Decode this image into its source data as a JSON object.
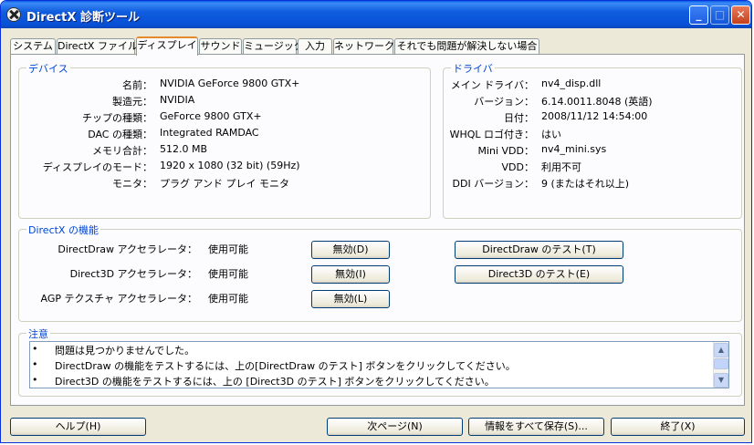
{
  "window": {
    "title": "DirectX 診断ツール"
  },
  "tabs": [
    {
      "label": "システム"
    },
    {
      "label": "DirectX ファイル"
    },
    {
      "label": "ディスプレイ"
    },
    {
      "label": "サウンド"
    },
    {
      "label": "ミュージック"
    },
    {
      "label": "入力"
    },
    {
      "label": "ネットワーク"
    },
    {
      "label": "それでも問題が解決しない場合"
    }
  ],
  "device": {
    "title": "デバイス",
    "rows": [
      {
        "label": "名前：",
        "value": "NVIDIA GeForce 9800 GTX+"
      },
      {
        "label": "製造元：",
        "value": "NVIDIA"
      },
      {
        "label": "チップの種類：",
        "value": "GeForce 9800 GTX+"
      },
      {
        "label": "DAC の種類：",
        "value": "Integrated RAMDAC"
      },
      {
        "label": "メモリ合計：",
        "value": "512.0 MB"
      },
      {
        "label": "ディスプレイのモード：",
        "value": "1920 x 1080 (32 bit) (59Hz)"
      },
      {
        "label": "モニタ：",
        "value": "プラグ アンド プレイ モニタ"
      }
    ]
  },
  "driver": {
    "title": "ドライバ",
    "rows": [
      {
        "label": "メイン ドライバ：",
        "value": "nv4_disp.dll"
      },
      {
        "label": "バージョン：",
        "value": "6.14.0011.8048 (英語)"
      },
      {
        "label": "日付：",
        "value": "2008/11/12 14:54:00"
      },
      {
        "label": "WHQL ロゴ付き：",
        "value": "はい"
      },
      {
        "label": "Mini VDD：",
        "value": "nv4_mini.sys"
      },
      {
        "label": "VDD：",
        "value": "利用不可"
      },
      {
        "label": "DDI バージョン：",
        "value": "9 (またはそれ以上)"
      }
    ]
  },
  "features": {
    "title": "DirectX の機能",
    "rows": [
      {
        "label": "DirectDraw アクセラレータ：",
        "status": "使用可能",
        "disable_button": "無効(D)",
        "test_button": "DirectDraw のテスト(T)"
      },
      {
        "label": "Direct3D アクセラレータ：",
        "status": "使用可能",
        "disable_button": "無効(I)",
        "test_button": "Direct3D のテスト(E)"
      },
      {
        "label": "AGP テクスチャ アクセラレータ：",
        "status": "使用可能",
        "disable_button": "無効(L)"
      }
    ]
  },
  "notes": {
    "title": "注意",
    "bullet": "•",
    "items": [
      "問題は見つかりませんでした。",
      "DirectDraw の機能をテストするには、上の[DirectDraw のテスト] ボタンをクリックしてください。",
      "Direct3D の機能をテストするには、上の [Direct3D のテスト] ボタンをクリックしてください。"
    ]
  },
  "buttons": {
    "help": "ヘルプ(H)",
    "next": "次ページ(N)",
    "save": "情報をすべて保存(S)...",
    "exit": "終了(X)"
  },
  "icons": {
    "app": "directx-icon",
    "minimize": "minimize-icon",
    "maximize": "maximize-icon",
    "close": "close-icon",
    "scroll_up": "scroll-up-arrow-icon",
    "scroll_down": "scroll-down-arrow-icon"
  },
  "colors": {
    "titlebar": "#0750d6",
    "group_title": "#0046d5",
    "active_tab_accent": "#e68b2c",
    "window_bg": "#ece9d8"
  }
}
